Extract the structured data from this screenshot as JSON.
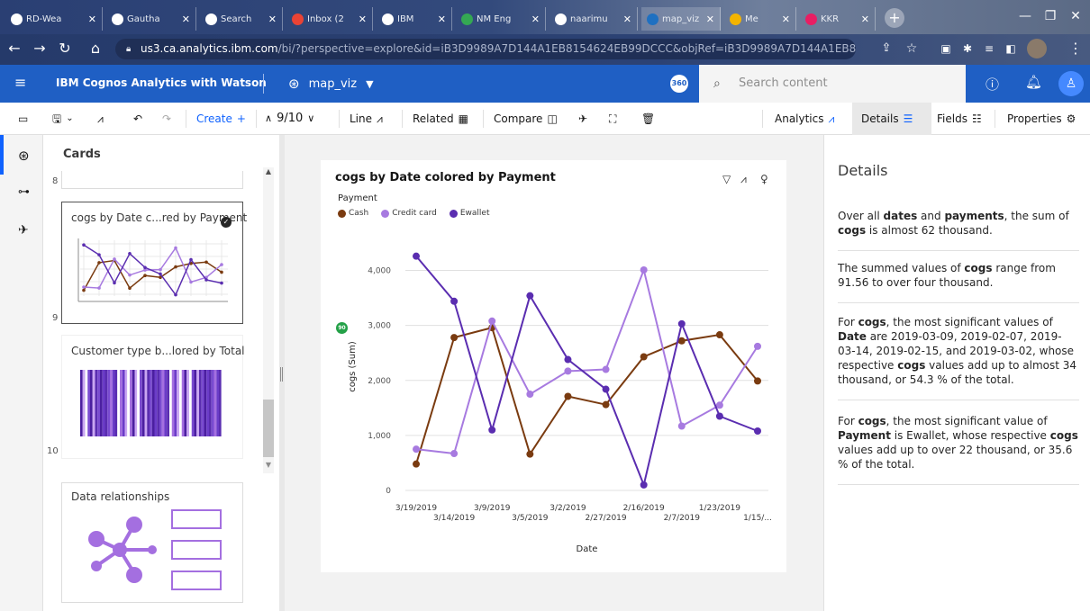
{
  "browser": {
    "tabs": [
      {
        "label": "RD-Wea",
        "color": "#ffffff"
      },
      {
        "label": "Gautha",
        "color": "#ffffff"
      },
      {
        "label": "Search",
        "color": "#ffffff"
      },
      {
        "label": "Inbox (2",
        "color": "#ea4335"
      },
      {
        "label": "IBM",
        "color": "#ffffff"
      },
      {
        "label": "NM Eng",
        "color": "#34a853"
      },
      {
        "label": "naarimu",
        "color": "#ffffff"
      },
      {
        "label": "map_viz",
        "color": "#1f70c1"
      },
      {
        "label": "Me",
        "color": "#f4b400"
      },
      {
        "label": "KKR",
        "color": "#e91e63"
      }
    ],
    "url_host": "us3.ca.analytics.ibm.com",
    "url_rest": "/bi/?perspective=explore&id=iB3D9989A7D144A1EB8154624EB99DCCC&objRef=iB3D9989A7D144A1EB8154624EB99DCC..."
  },
  "app": {
    "title": "IBM Cognos Analytics with Watson",
    "viz_name": "map_viz",
    "badge": "360",
    "search_placeholder": "Search content"
  },
  "toolbar": {
    "create": "Create",
    "pager": "9/10",
    "line": "Line",
    "related": "Related",
    "compare": "Compare",
    "analytics": "Analytics",
    "details": "Details",
    "fields": "Fields",
    "properties": "Properties"
  },
  "cards_panel": {
    "title": "Cards",
    "num_8": "8",
    "num_9": "9",
    "num_10": "10",
    "card1_title": "cogs by Date c...red by Payment",
    "card2_title": "Customer type b...lored by Total",
    "card3_title": "Data relationships"
  },
  "chart_card": {
    "title": "cogs by Date colored by Payment",
    "legend_title": "Payment",
    "badge": "90"
  },
  "chart_data": {
    "type": "line",
    "title": "cogs by Date colored by Payment",
    "xlabel": "Date",
    "ylabel": "cogs (Sum)",
    "ylim": [
      0,
      4500
    ],
    "yticks": [
      "0",
      "1,000",
      "2,000",
      "3,000",
      "4,000"
    ],
    "ytick_values": [
      0,
      1000,
      2000,
      3000,
      4000
    ],
    "x": [
      "3/19/2019",
      "3/14/2019",
      "3/9/2019",
      "3/5/2019",
      "3/2/2019",
      "2/27/2019",
      "2/16/2019",
      "2/7/2019",
      "1/23/2019",
      "1/15/..."
    ],
    "x_tick_labels": [
      "3/19/2019",
      "3/14/2019",
      "3/9/2019",
      "3/5/2019",
      "3/2/2019",
      "2/27/2019",
      "2/16/2019",
      "2/7/2019",
      "1/23/2019",
      "1/15/..."
    ],
    "grid": true,
    "legend_position": "top-left",
    "series": [
      {
        "name": "Cash",
        "color": "#7a3b10",
        "values": [
          480,
          2780,
          2960,
          660,
          1710,
          1560,
          2430,
          2720,
          2830,
          1990
        ]
      },
      {
        "name": "Credit card",
        "color": "#a77ae0",
        "values": [
          750,
          670,
          3080,
          1750,
          2170,
          2200,
          4010,
          1170,
          1550,
          2620
        ]
      },
      {
        "name": "Ewallet",
        "color": "#5a2db0",
        "values": [
          4260,
          3440,
          1100,
          3540,
          2380,
          1840,
          100,
          3030,
          1350,
          1080
        ]
      }
    ]
  },
  "details": {
    "heading": "Details",
    "p1": [
      "Over all ",
      "dates",
      " and ",
      "payments",
      ", the sum of ",
      "cogs",
      " is almost 62 thousand."
    ],
    "p2": [
      "The summed values of ",
      "cogs",
      " range from 91.56 to over four thousand."
    ],
    "p3": [
      "For ",
      "cogs",
      ", the most significant values of ",
      "Date",
      " are 2019-03-09, 2019-02-07, 2019-03-14, 2019-02-15, and 2019-03-02, whose respective ",
      "cogs",
      " values add up to almost 34 thousand, or 54.3 % of the total."
    ],
    "p4": [
      "For ",
      "cogs",
      ", the most significant value of ",
      "Payment",
      " is Ewallet, whose respective ",
      "cogs",
      " values add up to over 22 thousand, or 35.6 % of the total."
    ]
  }
}
